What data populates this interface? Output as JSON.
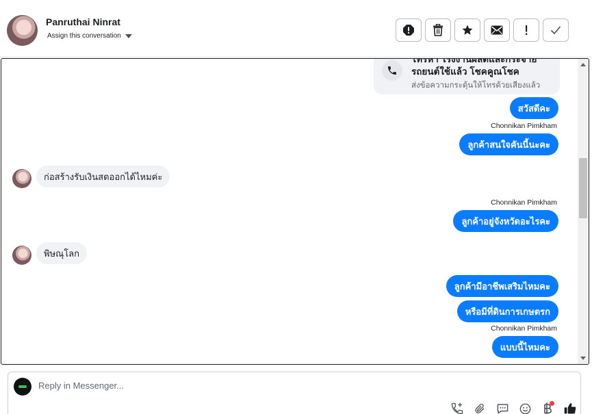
{
  "header": {
    "contact_name": "Panruthai Ninrat",
    "assign_label": "Assign this conversation"
  },
  "call_card": {
    "title": "โทรหา โรงงานผลิตและกระจายรถยนต์ใช้แล้ว โชคคูณโชค",
    "subtitle": "ส่งข้อความกระตุ้นให้โทรด้วยเสียงแล้ว"
  },
  "messages": {
    "m1": "สวัสดีคะ",
    "sender1": "Chonnikan Pimkham",
    "m2": "ลูกค้าสนใจคันนี้นะคะ",
    "m3": "ก่อสร้างรับเงินสดออกได้ไหมค่ะ",
    "sender2": "Chonnikan Pimkham",
    "m4": "ลูกค้าอยู่จังหวัดอะไรคะ",
    "m5": "พิษณุโลก",
    "m6": "ลูกค้ามีอาชีพเสริมไหมคะ",
    "m7": "หรือมีที่ดินการเกษตรก",
    "sender3": "Chonnikan Pimkham",
    "m8": "แบบนี้ไหมคะ"
  },
  "reply": {
    "placeholder": "Reply in Messenger..."
  },
  "icons": {
    "actions": [
      "alert-icon",
      "trash-icon",
      "star-icon",
      "mail-icon",
      "exclamation-icon",
      "check-icon"
    ],
    "tools": [
      "add-call-icon",
      "paperclip-icon",
      "chat-bubble-icon",
      "emoji-icon",
      "baht-icon",
      "thumbs-up-icon"
    ]
  },
  "colors": {
    "outgoing_bubble": "#0a7cff",
    "incoming_bubble": "#f0f2f5",
    "notification_dot": "#fa383e"
  }
}
